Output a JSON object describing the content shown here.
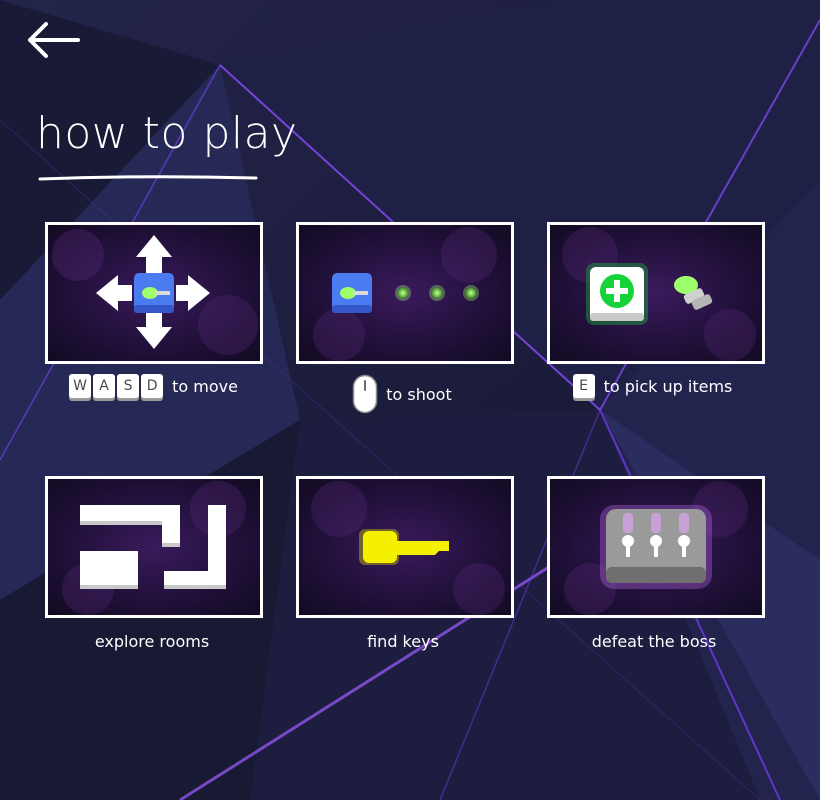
{
  "page": {
    "title": "how to play",
    "back_icon": "arrow-left-icon"
  },
  "cards": [
    {
      "id": "move",
      "keys": [
        "W",
        "A",
        "S",
        "D"
      ],
      "caption": "to move",
      "icon": "arrows-move-icon"
    },
    {
      "id": "shoot",
      "caption": "to shoot",
      "icon": "mouse-icon"
    },
    {
      "id": "pickup",
      "keys": [
        "E"
      ],
      "caption": "to pick up items",
      "icon": "health-pickup-icon"
    },
    {
      "id": "explore",
      "caption": "explore rooms",
      "icon": "rooms-map-icon"
    },
    {
      "id": "keys",
      "caption": "find keys",
      "icon": "key-icon"
    },
    {
      "id": "boss",
      "caption": "defeat the boss",
      "icon": "boss-icon"
    }
  ],
  "colors": {
    "background": "#1b1c3a",
    "accent_purple": "#7b3cff",
    "player_blue": "#4a7bf0",
    "bullet_green": "#9dff6a",
    "key_yellow": "#f5f000",
    "health_green": "#18d23a"
  }
}
